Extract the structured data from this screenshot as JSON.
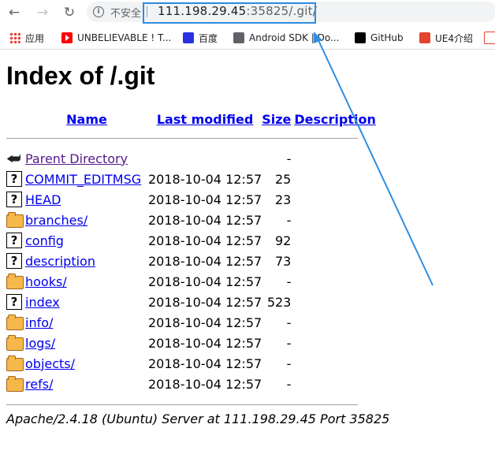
{
  "browser": {
    "back_icon": "arrow-left-icon",
    "forward_icon": "arrow-right-icon",
    "reload_icon": "reload-icon",
    "security_label": "不安全",
    "url_host": "111.198.29.45",
    "url_rest": ":35825/.git/",
    "highlight_color": "#2e8ee0"
  },
  "bookmarks": [
    {
      "label": "应用",
      "icon": "apps-icon"
    },
    {
      "label": "UNBELIEVABLE ! T...",
      "icon": "youtube-icon"
    },
    {
      "label": "百度",
      "icon": "baidu-icon"
    },
    {
      "label": "Android SDK | Do...",
      "icon": "globe-icon"
    },
    {
      "label": "GitHub",
      "icon": "github-icon"
    },
    {
      "label": "UE4介绍",
      "icon": "flame-icon"
    }
  ],
  "page": {
    "title": "Index of /.git",
    "headers": {
      "name": "Name",
      "last_modified": "Last modified",
      "size": "Size",
      "description": "Description"
    },
    "rows": [
      {
        "icon": "back-icon",
        "name": "Parent Directory",
        "date": "",
        "size": "-"
      },
      {
        "icon": "unknown-file-icon",
        "name": "COMMIT_EDITMSG",
        "date": "2018-10-04 12:57",
        "size": "25"
      },
      {
        "icon": "unknown-file-icon",
        "name": "HEAD",
        "date": "2018-10-04 12:57",
        "size": "23"
      },
      {
        "icon": "folder-icon",
        "name": "branches/",
        "date": "2018-10-04 12:57",
        "size": "-"
      },
      {
        "icon": "unknown-file-icon",
        "name": "config",
        "date": "2018-10-04 12:57",
        "size": "92"
      },
      {
        "icon": "unknown-file-icon",
        "name": "description",
        "date": "2018-10-04 12:57",
        "size": "73"
      },
      {
        "icon": "folder-icon",
        "name": "hooks/",
        "date": "2018-10-04 12:57",
        "size": "-"
      },
      {
        "icon": "unknown-file-icon",
        "name": "index",
        "date": "2018-10-04 12:57",
        "size": "523"
      },
      {
        "icon": "folder-icon",
        "name": "info/",
        "date": "2018-10-04 12:57",
        "size": "-"
      },
      {
        "icon": "folder-icon",
        "name": "logs/",
        "date": "2018-10-04 12:57",
        "size": "-"
      },
      {
        "icon": "folder-icon",
        "name": "objects/",
        "date": "2018-10-04 12:57",
        "size": "-"
      },
      {
        "icon": "folder-icon",
        "name": "refs/",
        "date": "2018-10-04 12:57",
        "size": "-"
      }
    ],
    "footer": "Apache/2.4.18 (Ubuntu) Server at 111.198.29.45 Port 35825"
  }
}
